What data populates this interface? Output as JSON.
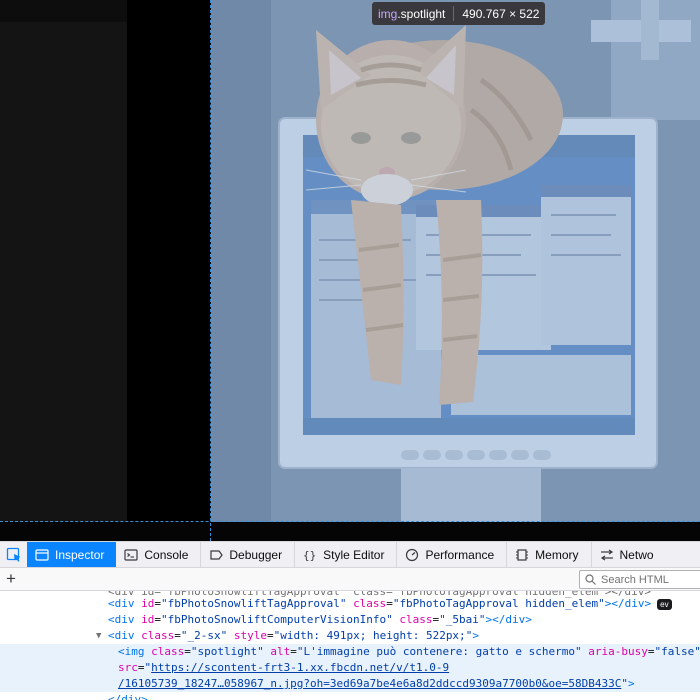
{
  "infobar": {
    "tag": "img",
    "class_name": ".spotlight",
    "dimensions": "490.767 × 522"
  },
  "toolbar": {
    "tabs": [
      {
        "label": "Inspector",
        "icon": "inspector-icon"
      },
      {
        "label": "Console",
        "icon": "console-icon"
      },
      {
        "label": "Debugger",
        "icon": "debugger-icon"
      },
      {
        "label": "Style Editor",
        "icon": "style-editor-icon"
      },
      {
        "label": "Performance",
        "icon": "performance-icon"
      },
      {
        "label": "Memory",
        "icon": "memory-icon"
      },
      {
        "label": "Netwo",
        "icon": "network-icon"
      }
    ],
    "active_tab": "Inspector"
  },
  "search": {
    "placeholder": "Search HTML"
  },
  "markup": {
    "line0": "<div id=\"fbPhotoSnowliftTagApproval\" class=\"fbPhotoTagApproval hidden_elem\"></div>",
    "line1_id": "fbPhotoSnowliftTagApproval",
    "line1_class": "fbPhotoTagApproval hidden_elem",
    "line2_id": "fbPhotoSnowliftComputerVisionInfo",
    "line2_class": "_5bai",
    "line3_class": "_2-sx",
    "line3_style": "width: 491px; height: 522px;",
    "line4_class": "spotlight",
    "line4_alt": "L'immagine può contenere: gatto e schermo",
    "line4_aria": "false",
    "line5_src_a": "https://scontent-frt3-1.xx.fbcdn.net/v/t1.0-9",
    "line6_src_b": "/16105739_18247…058967_n.jpg?oh=3ed69a7be4e6a8d2ddccd9309a7700b0&oe=58DB433C",
    "line7_close": "</div>",
    "event_badge": "ev",
    "tag_div": "div",
    "tag_img": "img",
    "attr_id": "id",
    "attr_class": "class",
    "attr_style": "style",
    "attr_alt": "alt",
    "attr_aria": "aria-busy",
    "attr_src": "src"
  },
  "colors": {
    "active_tab": "#0a84ff",
    "guide": "#3b8fd9",
    "tag": "#0074e8",
    "attr_name": "#dd00a9",
    "attr_value": "#003eaa"
  }
}
